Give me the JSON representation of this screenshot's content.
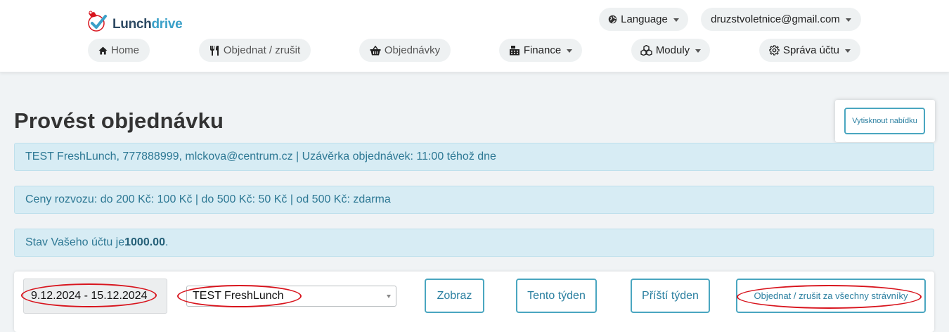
{
  "app": {
    "logo_part1": "Lunch",
    "logo_part2": "drive"
  },
  "header": {
    "language_label": "Language",
    "user_email": "druzstvoletnice@gmail.com"
  },
  "nav": {
    "home": "Home",
    "order_cancel": "Objednat / zrušit",
    "orders": "Objednávky",
    "finance": "Finance",
    "modules": "Moduly",
    "account": "Správa účtu"
  },
  "page": {
    "title": "Provést objednávku",
    "print_button": "Vytisknout nabídku"
  },
  "alerts": {
    "restaurant_info": "TEST FreshLunch, 777888999, mlckova@centrum.cz | Uzávěrka objednávek: 11:00 téhož dne",
    "delivery_prices": "Ceny rozvozu: do 200 Kč: 100 Kč | do 500 Kč: 50 Kč | od 500 Kč: zdarma",
    "balance_prefix": "Stav Vašeho účtu je ",
    "balance_value": "1000.00",
    "balance_suffix": "."
  },
  "toolbar": {
    "date_range": "9.12.2024 - 15.12.2024",
    "restaurant_selected": "TEST FreshLunch",
    "show_button": "Zobraz",
    "this_week_button": "Tento týden",
    "next_week_button": "Příští týden",
    "order_all_button": "Objednat / zrušit za všechny strávníky"
  },
  "colors": {
    "accent": "#4aa6c0",
    "alert_bg": "#d7ecf4",
    "alert_text": "#2d7894",
    "annotation": "#d8141d"
  }
}
